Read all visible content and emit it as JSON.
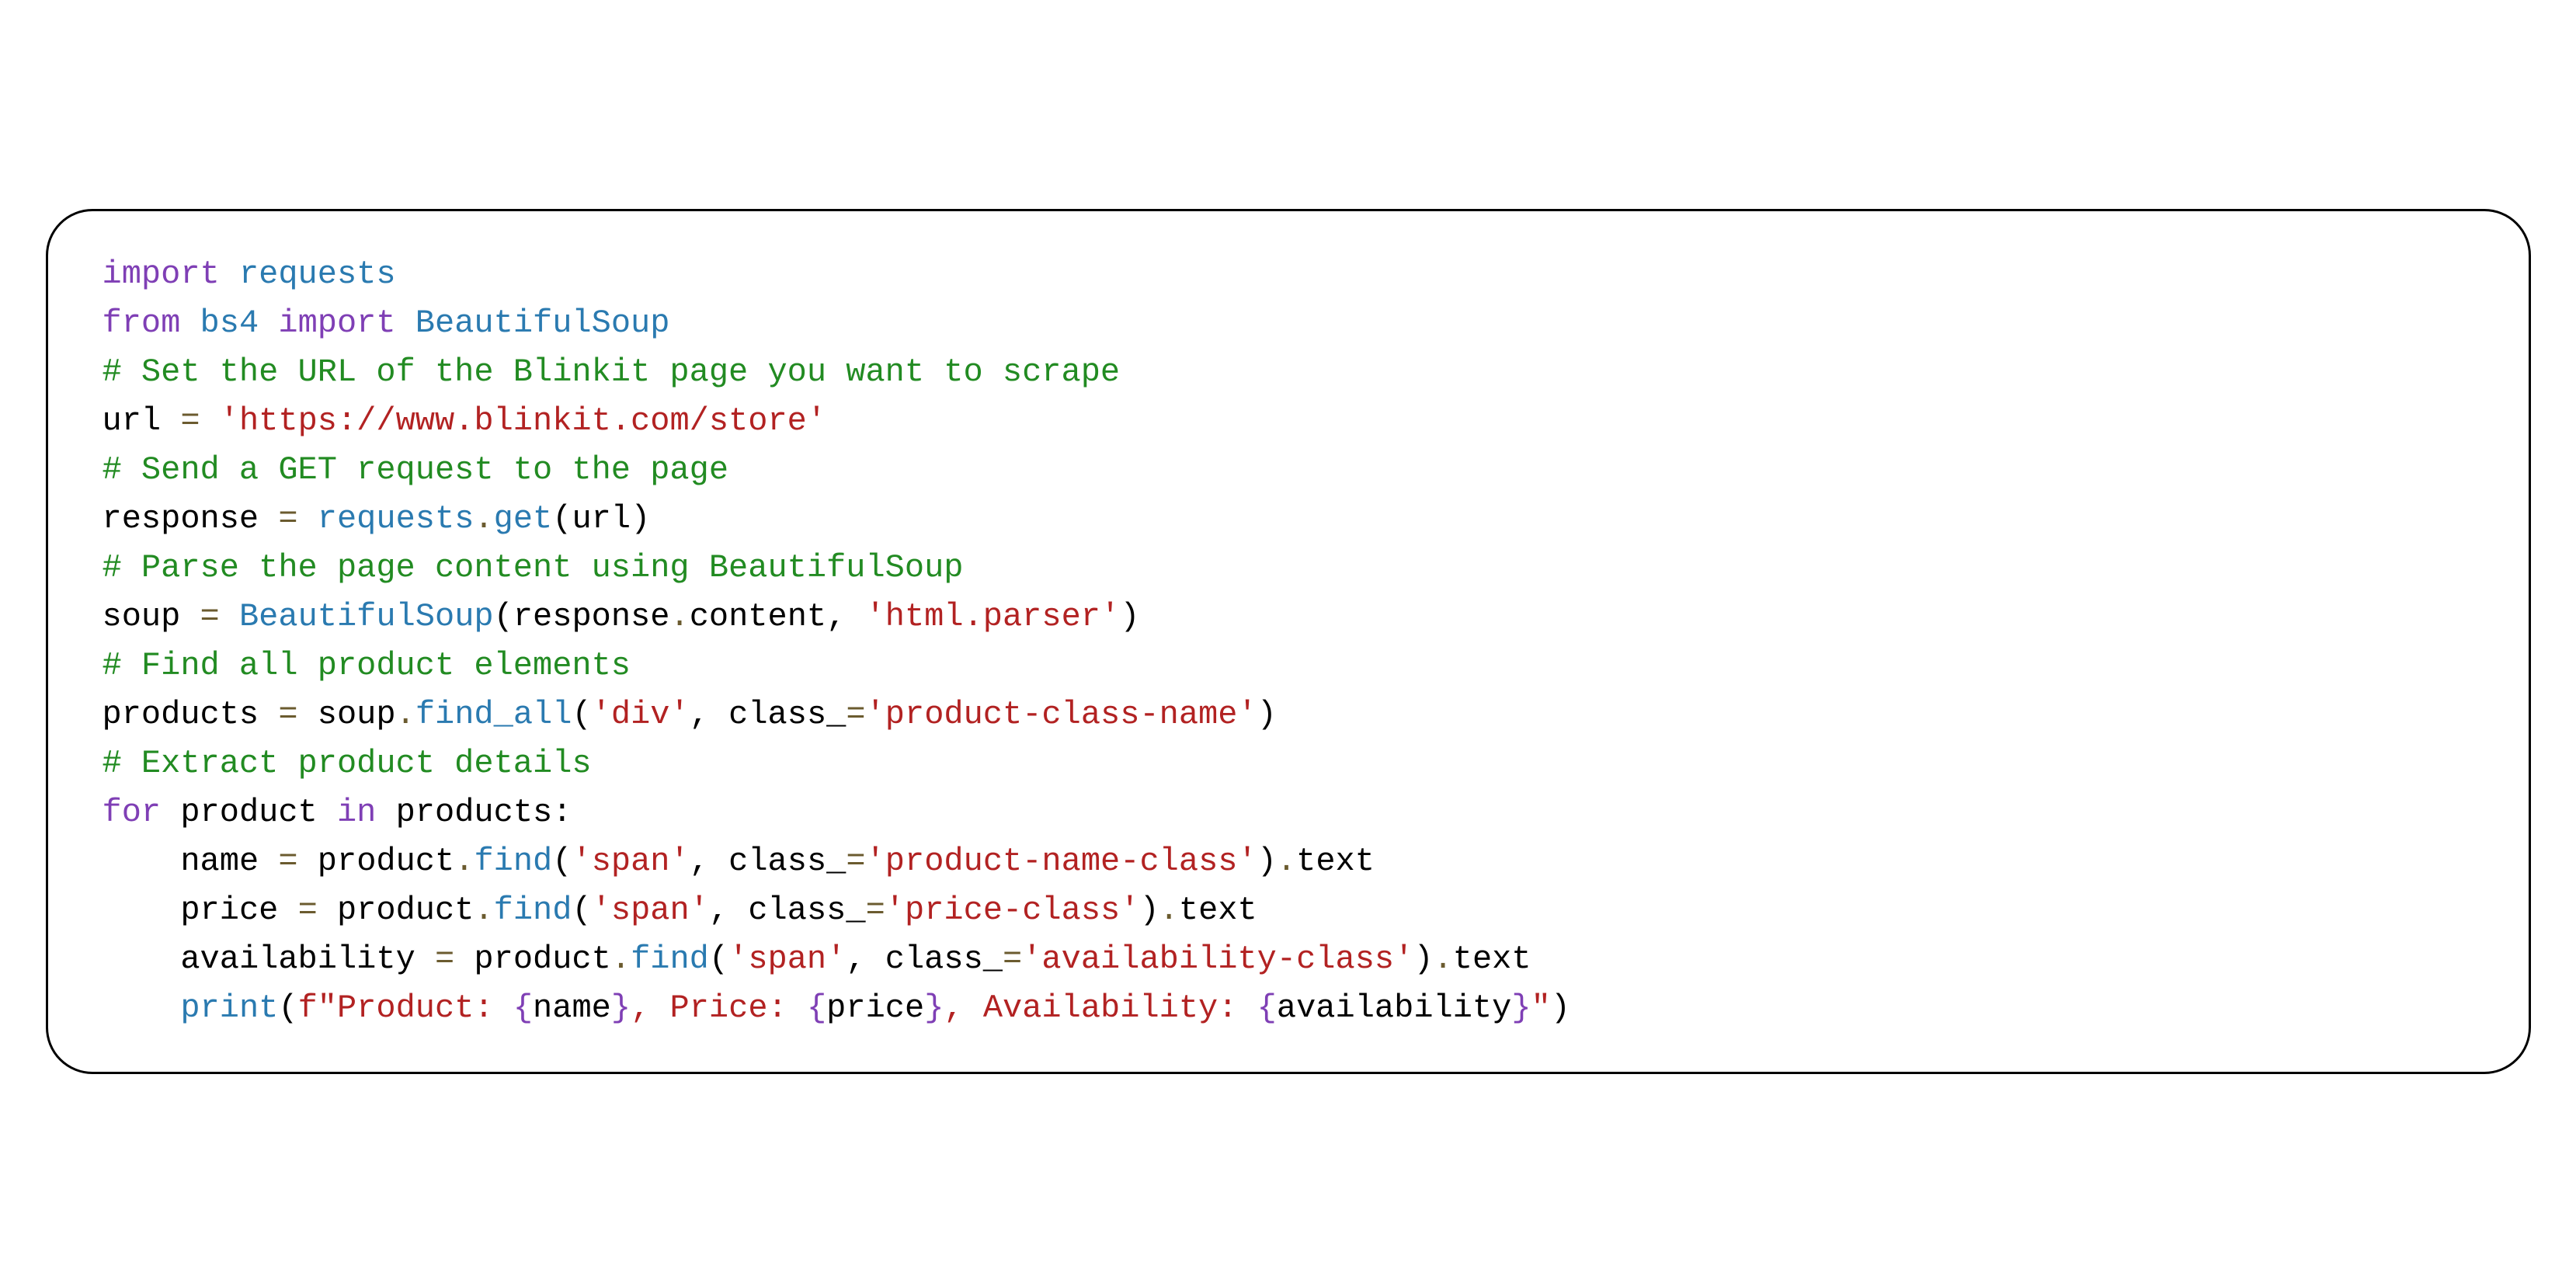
{
  "code": {
    "lines": [
      {
        "type": "import",
        "tokens": [
          {
            "t": "import ",
            "c": "keyword"
          },
          {
            "t": "requests",
            "c": "module"
          }
        ]
      },
      {
        "type": "import",
        "tokens": [
          {
            "t": "from ",
            "c": "keyword"
          },
          {
            "t": "bs4 ",
            "c": "module"
          },
          {
            "t": "import ",
            "c": "keyword"
          },
          {
            "t": "BeautifulSoup",
            "c": "module"
          }
        ]
      },
      {
        "type": "comment",
        "tokens": [
          {
            "t": "# Set the URL of the Blinkit page you want to scrape",
            "c": "comment"
          }
        ]
      },
      {
        "type": "assign",
        "tokens": [
          {
            "t": "url ",
            "c": "variable"
          },
          {
            "t": "= ",
            "c": "operator"
          },
          {
            "t": "'https://www.blinkit.com/store'",
            "c": "string"
          }
        ]
      },
      {
        "type": "comment",
        "tokens": [
          {
            "t": "# Send a GET request to the page",
            "c": "comment"
          }
        ]
      },
      {
        "type": "assign",
        "tokens": [
          {
            "t": "response ",
            "c": "variable"
          },
          {
            "t": "= ",
            "c": "operator"
          },
          {
            "t": "requests",
            "c": "module"
          },
          {
            "t": ".",
            "c": "operator"
          },
          {
            "t": "get",
            "c": "function-call"
          },
          {
            "t": "(",
            "c": "paren"
          },
          {
            "t": "url",
            "c": "variable"
          },
          {
            "t": ")",
            "c": "paren"
          }
        ]
      },
      {
        "type": "comment",
        "tokens": [
          {
            "t": "# Parse the page content using BeautifulSoup",
            "c": "comment"
          }
        ]
      },
      {
        "type": "assign",
        "tokens": [
          {
            "t": "soup ",
            "c": "variable"
          },
          {
            "t": "= ",
            "c": "operator"
          },
          {
            "t": "BeautifulSoup",
            "c": "module"
          },
          {
            "t": "(",
            "c": "paren"
          },
          {
            "t": "response",
            "c": "variable"
          },
          {
            "t": ".",
            "c": "operator"
          },
          {
            "t": "content",
            "c": "attr"
          },
          {
            "t": ", ",
            "c": "paren"
          },
          {
            "t": "'html.parser'",
            "c": "string"
          },
          {
            "t": ")",
            "c": "paren"
          }
        ]
      },
      {
        "type": "comment",
        "tokens": [
          {
            "t": "# Find all product elements",
            "c": "comment"
          }
        ]
      },
      {
        "type": "assign",
        "tokens": [
          {
            "t": "products ",
            "c": "variable"
          },
          {
            "t": "= ",
            "c": "operator"
          },
          {
            "t": "soup",
            "c": "variable"
          },
          {
            "t": ".",
            "c": "operator"
          },
          {
            "t": "find_all",
            "c": "function-call"
          },
          {
            "t": "(",
            "c": "paren"
          },
          {
            "t": "'div'",
            "c": "string"
          },
          {
            "t": ", ",
            "c": "paren"
          },
          {
            "t": "class_",
            "c": "variable"
          },
          {
            "t": "=",
            "c": "operator"
          },
          {
            "t": "'product-class-name'",
            "c": "string"
          },
          {
            "t": ")",
            "c": "paren"
          }
        ]
      },
      {
        "type": "comment",
        "tokens": [
          {
            "t": "# Extract product details",
            "c": "comment"
          }
        ]
      },
      {
        "type": "for",
        "tokens": [
          {
            "t": "for ",
            "c": "keyword"
          },
          {
            "t": "product ",
            "c": "variable"
          },
          {
            "t": "in ",
            "c": "keyword"
          },
          {
            "t": "products",
            "c": "variable"
          },
          {
            "t": ":",
            "c": "paren"
          }
        ]
      },
      {
        "type": "assign",
        "indent": 1,
        "tokens": [
          {
            "t": "name ",
            "c": "variable"
          },
          {
            "t": "= ",
            "c": "operator"
          },
          {
            "t": "product",
            "c": "variable"
          },
          {
            "t": ".",
            "c": "operator"
          },
          {
            "t": "find",
            "c": "function-call"
          },
          {
            "t": "(",
            "c": "paren"
          },
          {
            "t": "'span'",
            "c": "string"
          },
          {
            "t": ", ",
            "c": "paren"
          },
          {
            "t": "class_",
            "c": "variable"
          },
          {
            "t": "=",
            "c": "operator"
          },
          {
            "t": "'product-name-class'",
            "c": "string"
          },
          {
            "t": ")",
            "c": "paren"
          },
          {
            "t": ".",
            "c": "operator"
          },
          {
            "t": "text",
            "c": "attr"
          }
        ]
      },
      {
        "type": "assign",
        "indent": 1,
        "tokens": [
          {
            "t": "price ",
            "c": "variable"
          },
          {
            "t": "= ",
            "c": "operator"
          },
          {
            "t": "product",
            "c": "variable"
          },
          {
            "t": ".",
            "c": "operator"
          },
          {
            "t": "find",
            "c": "function-call"
          },
          {
            "t": "(",
            "c": "paren"
          },
          {
            "t": "'span'",
            "c": "string"
          },
          {
            "t": ", ",
            "c": "paren"
          },
          {
            "t": "class_",
            "c": "variable"
          },
          {
            "t": "=",
            "c": "operator"
          },
          {
            "t": "'price-class'",
            "c": "string"
          },
          {
            "t": ")",
            "c": "paren"
          },
          {
            "t": ".",
            "c": "operator"
          },
          {
            "t": "text",
            "c": "attr"
          }
        ]
      },
      {
        "type": "assign",
        "indent": 1,
        "tokens": [
          {
            "t": "availability ",
            "c": "variable"
          },
          {
            "t": "= ",
            "c": "operator"
          },
          {
            "t": "product",
            "c": "variable"
          },
          {
            "t": ".",
            "c": "operator"
          },
          {
            "t": "find",
            "c": "function-call"
          },
          {
            "t": "(",
            "c": "paren"
          },
          {
            "t": "'span'",
            "c": "string"
          },
          {
            "t": ", ",
            "c": "paren"
          },
          {
            "t": "class_",
            "c": "variable"
          },
          {
            "t": "=",
            "c": "operator"
          },
          {
            "t": "'availability-class'",
            "c": "string"
          },
          {
            "t": ")",
            "c": "paren"
          },
          {
            "t": ".",
            "c": "operator"
          },
          {
            "t": "text",
            "c": "attr"
          }
        ]
      },
      {
        "type": "print",
        "indent": 1,
        "tokens": [
          {
            "t": "print",
            "c": "function-call"
          },
          {
            "t": "(",
            "c": "paren"
          },
          {
            "t": "f\"Product: ",
            "c": "string"
          },
          {
            "t": "{",
            "c": "fstring-brace"
          },
          {
            "t": "name",
            "c": "variable"
          },
          {
            "t": "}",
            "c": "fstring-brace"
          },
          {
            "t": ", Price: ",
            "c": "string"
          },
          {
            "t": "{",
            "c": "fstring-brace"
          },
          {
            "t": "price",
            "c": "variable"
          },
          {
            "t": "}",
            "c": "fstring-brace"
          },
          {
            "t": ", Availability: ",
            "c": "string"
          },
          {
            "t": "{",
            "c": "fstring-brace"
          },
          {
            "t": "availability",
            "c": "variable"
          },
          {
            "t": "}",
            "c": "fstring-brace"
          },
          {
            "t": "\"",
            "c": "string"
          },
          {
            "t": ")",
            "c": "paren"
          }
        ]
      }
    ]
  }
}
